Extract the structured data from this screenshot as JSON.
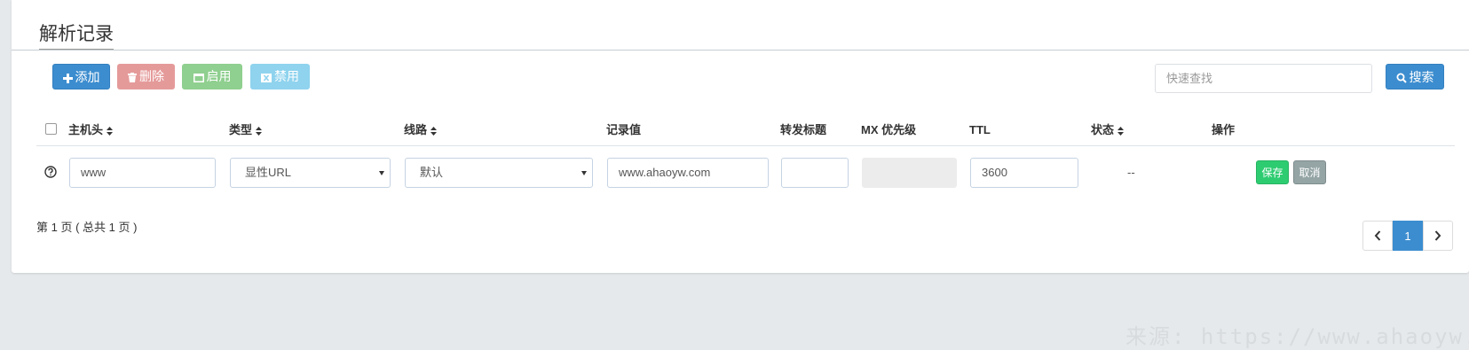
{
  "panel": {
    "title": "解析记录"
  },
  "toolbar": {
    "add_label": "添加",
    "delete_label": "删除",
    "enable_label": "启用",
    "disable_label": "禁用",
    "search_placeholder": "快速查找",
    "search_label": "搜索"
  },
  "table": {
    "columns": [
      "主机头",
      "类型",
      "线路",
      "记录值",
      "转发标题",
      "MX 优先级",
      "TTL",
      "状态",
      "操作"
    ],
    "row": {
      "host": "www",
      "type": "显性URL",
      "line": "默认",
      "value": "www.ahaoyw.com",
      "forward_title": "",
      "mx_priority": "",
      "ttl": "3600",
      "status": "--",
      "save_label": "保存",
      "cancel_label": "取消"
    }
  },
  "pagination": {
    "info": "第 1 页 ( 总共 1 页 )",
    "current_page": "1"
  },
  "watermark": "来源: https://www.ahaoyw.com",
  "colors": {
    "primary": "#3c8dcf",
    "danger": "#e59a9a",
    "success": "#8fcf8f",
    "info": "#8fd3ee",
    "save": "#2ecc71",
    "cancel": "#95a5a6"
  }
}
